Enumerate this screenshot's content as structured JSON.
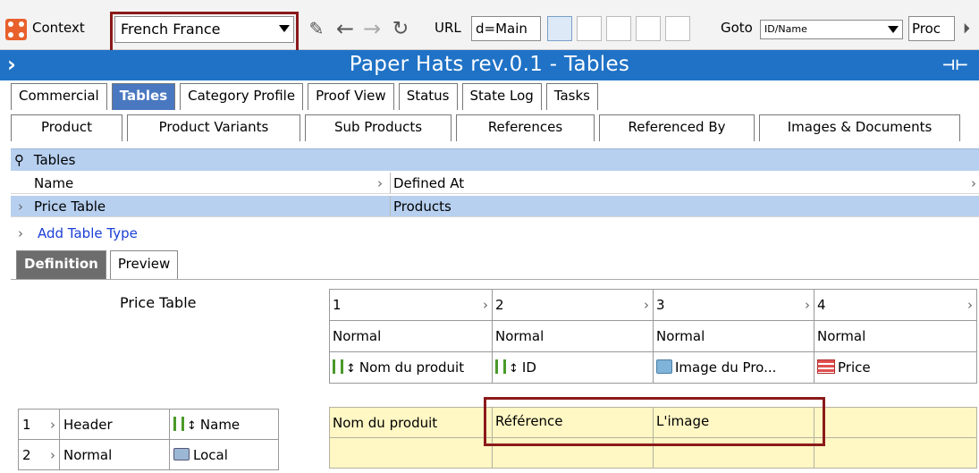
{
  "toolbar": {
    "context_label": "Context",
    "context_value": "French France",
    "url_label": "URL",
    "url_value": "d=Main",
    "goto_label": "Goto",
    "goto_value": "ID/Name",
    "prod_value": "Proc",
    "icons": [
      "app-logo-icon",
      "edit-icon",
      "back-arrow-icon",
      "forward-arrow-icon",
      "refresh-icon",
      "layout-a-icon",
      "comment-icon",
      "network-icon",
      "grid-icon",
      "window-icon",
      "next-icon"
    ]
  },
  "title": "Paper Hats rev.0.1 - Tables",
  "tabs_row1": [
    "Commercial",
    "Tables",
    "Category Profile",
    "Proof View",
    "Status",
    "State Log",
    "Tasks"
  ],
  "tabs_row2": [
    "Product",
    "Product Variants",
    "Sub Products",
    "References",
    "Referenced By",
    "Images & Documents"
  ],
  "tables": {
    "heading": "Tables",
    "columns": [
      "Name",
      "Defined At"
    ],
    "rows": [
      {
        "name": "Price Table",
        "defined_at": "Products"
      }
    ],
    "add_link": "Add Table Type"
  },
  "def_tabs": [
    "Definition",
    "Preview"
  ],
  "definition": {
    "table_title": "Price Table",
    "col_numbers": [
      "1",
      "2",
      "3",
      "4"
    ],
    "col_types": [
      "Normal",
      "Normal",
      "Normal",
      "Normal"
    ],
    "col_attrs": [
      "Nom du produit",
      "ID",
      "Image du Pro...",
      "Price"
    ],
    "rows": [
      {
        "num": "1",
        "type": "Header",
        "attr": "Name"
      },
      {
        "num": "2",
        "type": "Normal",
        "attr": "Local"
      }
    ],
    "data_row1": [
      "Nom du produit",
      "Référence",
      "L'image",
      ""
    ],
    "data_row2": [
      "",
      "",
      "",
      ""
    ]
  },
  "colors": {
    "accent": "#1f72c6",
    "selection": "#b7d0f0",
    "highlight": "#8b1a1a",
    "data_bg": "#fff7c4"
  }
}
